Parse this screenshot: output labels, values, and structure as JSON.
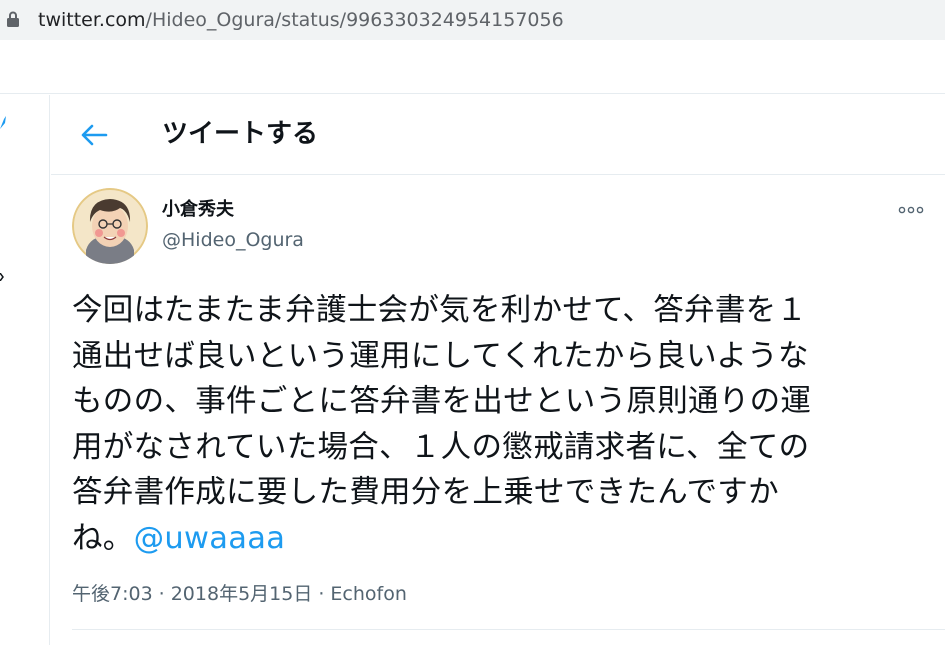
{
  "browser": {
    "url_host": "twitter.com",
    "url_path": "/Hideo_Ogura/status/996330324954157056",
    "lock_icon": "lock-icon"
  },
  "header": {
    "back_icon": "arrow-left-icon",
    "title": "ツイートする"
  },
  "tweet": {
    "author": {
      "display_name": "小倉秀夫",
      "handle": "@Hideo_Ogura",
      "avatar": "avatar-illustration"
    },
    "more_icon": "more-horizontal-icon",
    "text_lines": [
      "今回はたまたま弁護士会が気を利かせて、答弁書を１",
      "通出せば良いという運用にしてくれたから良いような",
      "ものの、事件ごとに答弁書を出せという原則通りの運",
      "用がなされていた場合、１人の懲戒請求者に、全ての",
      "答弁書作成に要した費用分を上乗せできたんですか"
    ],
    "last_line_prefix": "ね。",
    "mention": "@uwaaaa",
    "time": "午後7:03",
    "date": "2018年5月15日",
    "separator": "·",
    "source": "Echofon"
  },
  "colors": {
    "accent": "#1d9bf0",
    "text": "#0f1419",
    "secondary": "#536471",
    "border": "#e6ecf0",
    "addressbar": "#f1f3f4"
  }
}
